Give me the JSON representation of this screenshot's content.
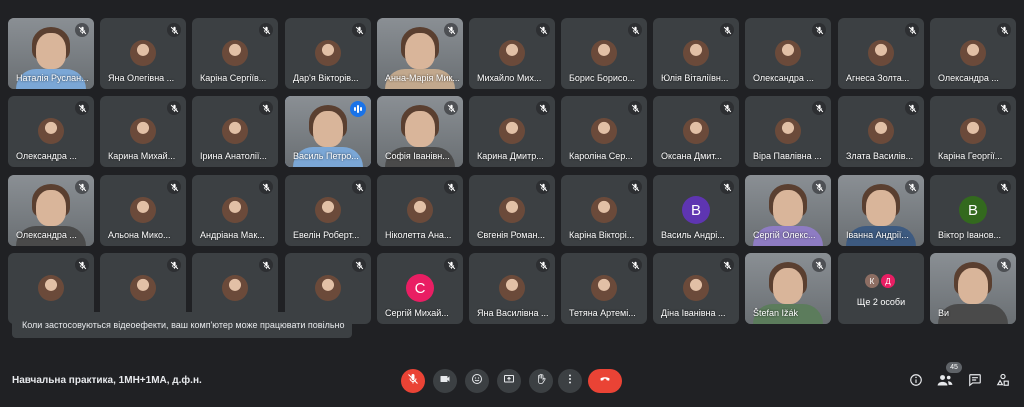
{
  "participants": [
    {
      "name": "Наталія Руслан...",
      "type": "video",
      "muted": true
    },
    {
      "name": "Яна Олегівна ...",
      "type": "avatar",
      "muted": true
    },
    {
      "name": "Каріна Сергіїв...",
      "type": "avatar",
      "muted": true
    },
    {
      "name": "Дар'я Вікторів...",
      "type": "avatar",
      "muted": true
    },
    {
      "name": "Анна-Марія Мик...",
      "type": "video",
      "muted": true
    },
    {
      "name": "Михайло Мих...",
      "type": "avatar",
      "muted": true
    },
    {
      "name": "Борис Борисо...",
      "type": "avatar",
      "muted": true
    },
    {
      "name": "Юлія Віталіївн...",
      "type": "avatar",
      "muted": true
    },
    {
      "name": "Олександра ...",
      "type": "avatar",
      "muted": true
    },
    {
      "name": "Агнеса Золта...",
      "type": "avatar",
      "muted": true
    },
    {
      "name": "Олександра ...",
      "type": "avatar",
      "muted": true
    },
    {
      "name": "Олександра ...",
      "type": "avatar",
      "muted": true
    },
    {
      "name": "Карина Михай...",
      "type": "avatar",
      "muted": true
    },
    {
      "name": "Ірина Анатолії...",
      "type": "avatar",
      "muted": true
    },
    {
      "name": "Василь Петро...",
      "type": "video",
      "muted": false,
      "speaking": true
    },
    {
      "name": "Софія Іванівн...",
      "type": "video",
      "muted": true
    },
    {
      "name": "Карина Дмитр...",
      "type": "avatar",
      "muted": true
    },
    {
      "name": "Кароліна Сер...",
      "type": "avatar",
      "muted": true
    },
    {
      "name": "Оксана Дмит...",
      "type": "avatar",
      "muted": true
    },
    {
      "name": "Віра Павлівна ...",
      "type": "avatar",
      "muted": true
    },
    {
      "name": "Злата Василів...",
      "type": "avatar",
      "muted": true
    },
    {
      "name": "Каріна Георгії...",
      "type": "avatar",
      "muted": true
    },
    {
      "name": "Олександра ...",
      "type": "video",
      "muted": true
    },
    {
      "name": "Альона Мико...",
      "type": "avatar",
      "muted": true
    },
    {
      "name": "Андріана Мак...",
      "type": "avatar",
      "muted": true
    },
    {
      "name": "Евелін Роберт...",
      "type": "avatar",
      "muted": true
    },
    {
      "name": "Ніколетта Ана...",
      "type": "avatar",
      "muted": true
    },
    {
      "name": "Євгенія Роман...",
      "type": "avatar",
      "muted": true
    },
    {
      "name": "Каріна Вікторі...",
      "type": "avatar",
      "muted": true
    },
    {
      "name": "Василь Андрі...",
      "type": "letter",
      "letter": "В",
      "color": "#5e35b1",
      "muted": true
    },
    {
      "name": "Сергій Олекс...",
      "type": "video",
      "muted": true
    },
    {
      "name": "Іванна Андрії...",
      "type": "video",
      "muted": true
    },
    {
      "name": "Віктор Іванов...",
      "type": "letter",
      "letter": "В",
      "color": "#33691e",
      "muted": true
    },
    {
      "name": "",
      "type": "avatar",
      "muted": true
    },
    {
      "name": "",
      "type": "avatar",
      "muted": true
    },
    {
      "name": "",
      "type": "avatar",
      "muted": true
    },
    {
      "name": "",
      "type": "avatar",
      "muted": true
    },
    {
      "name": "Сергій Михай...",
      "type": "letter",
      "letter": "С",
      "color": "#e91e63",
      "muted": true
    },
    {
      "name": "Яна Василівна ...",
      "type": "avatar",
      "muted": true
    },
    {
      "name": "Тетяна Артемі...",
      "type": "avatar",
      "muted": true
    },
    {
      "name": "Діна Іванівна ...",
      "type": "avatar",
      "muted": true
    },
    {
      "name": "Štefan Ižák",
      "type": "video",
      "muted": true
    },
    {
      "name": "",
      "type": "more",
      "label": "Ще 2 особи",
      "letters": [
        "К",
        "Д"
      ],
      "colors": [
        "#8d6e63",
        "#e91e63"
      ]
    },
    {
      "name": "Ви",
      "type": "video",
      "muted": true
    }
  ],
  "toast": "Коли застосовуються відеоефекти, ваш комп'ютер може працювати повільно",
  "meeting_title": "Навчальна практика, 1МН+1МА, д.ф.н.",
  "participant_count": "45",
  "controls": [
    "mic-off",
    "camera",
    "emoji",
    "present",
    "raise-hand",
    "more-options",
    "end-call"
  ],
  "right_controls": [
    "meeting-details",
    "people",
    "chat",
    "activities"
  ]
}
